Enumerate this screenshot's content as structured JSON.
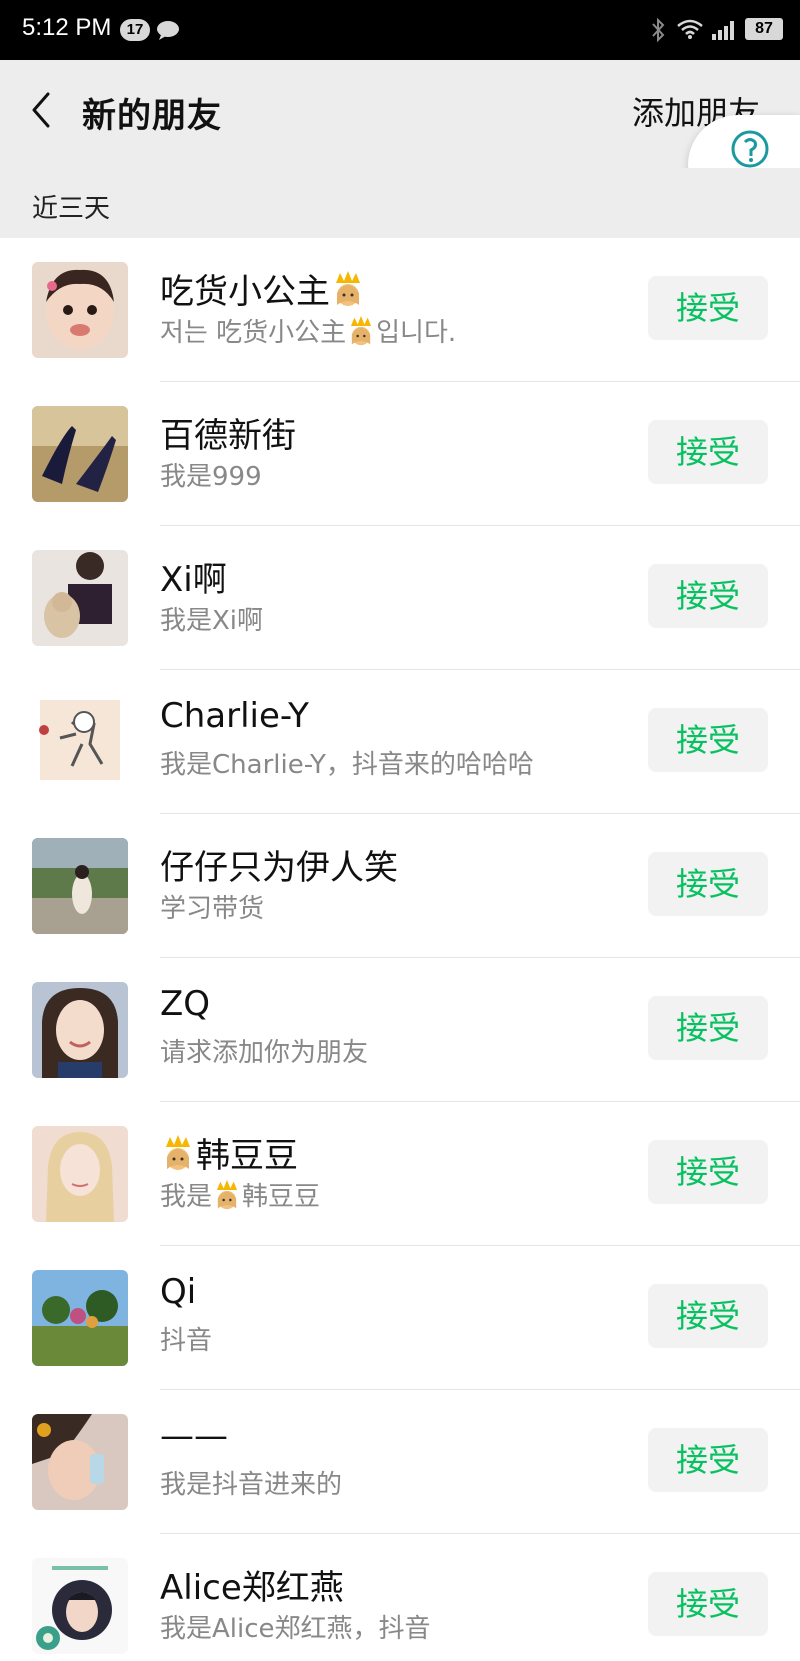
{
  "status_bar": {
    "time": "5:12 PM",
    "notification_count": "17",
    "battery": "87"
  },
  "header": {
    "title": "新的朋友",
    "add_friend": "添加朋友"
  },
  "section": {
    "label": "近三天"
  },
  "friends": [
    {
      "name_pre": "吃货小公主",
      "name_post": "",
      "name_emoji": "crown",
      "msg_pre": "저는 吃货小公主",
      "msg_post": "입니다.",
      "msg_emoji": "crown",
      "accept": "接受"
    },
    {
      "name_pre": "百德新街",
      "name_post": "",
      "msg_pre": "我是999",
      "msg_post": "",
      "accept": "接受"
    },
    {
      "name_pre": "Xi啊",
      "name_post": "",
      "msg_pre": "我是Xi啊",
      "msg_post": "",
      "accept": "接受"
    },
    {
      "name_pre": "Charlie-Y",
      "name_post": "",
      "msg_pre": "我是Charlie-Y，抖音来的哈哈哈",
      "msg_post": "",
      "accept": "接受"
    },
    {
      "name_pre": "仔仔只为伊人笑",
      "name_post": "",
      "msg_pre": "学习带货",
      "msg_post": "",
      "accept": "接受"
    },
    {
      "name_pre": "ZQ",
      "name_post": "",
      "msg_pre": "请求添加你为朋友",
      "msg_post": "",
      "accept": "接受"
    },
    {
      "name_pre": "",
      "name_post": "韩豆豆",
      "name_emoji": "crown",
      "msg_pre": "我是",
      "msg_post": "韩豆豆",
      "msg_emoji": "crown",
      "accept": "接受"
    },
    {
      "name_pre": "Qi",
      "name_post": "",
      "msg_pre": "抖音",
      "msg_post": "",
      "accept": "接受"
    },
    {
      "name_pre": "——",
      "name_post": "",
      "msg_pre": "我是抖音进来的",
      "msg_post": "",
      "accept": "接受"
    },
    {
      "name_pre": "Alice郑红燕",
      "name_post": "",
      "msg_pre": "我是Alice郑红燕，抖音",
      "msg_post": "",
      "accept": "接受"
    }
  ],
  "colors": {
    "accent": "#07c160",
    "background": "#ededed"
  },
  "icons": {
    "back": "chevron-left-icon",
    "crown": "crown-emoji-icon",
    "bluetooth": "bluetooth-icon",
    "wifi": "wifi-icon",
    "signal": "signal-icon",
    "message": "message-icon"
  }
}
